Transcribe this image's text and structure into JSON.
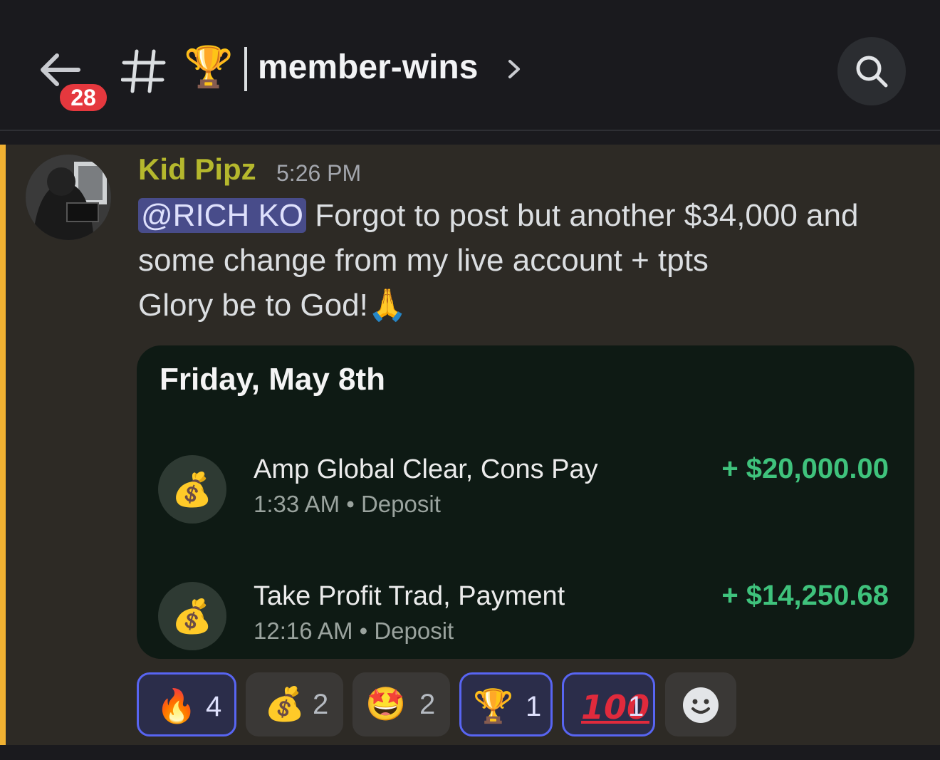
{
  "header": {
    "unread_badge": "28",
    "channel_emoji": "🏆",
    "channel_name": "member-wins",
    "icons": [
      "back-arrow-icon",
      "hash-icon",
      "chevron-right-icon",
      "search-icon"
    ]
  },
  "message": {
    "author": "Kid Pipz",
    "author_color": "#b5b82d",
    "timestamp": "5:26 PM",
    "mention": "@RICH KO",
    "text_line1": " Forgot to post but another $34,000 and",
    "text_line2": "some change from my live account + tpts",
    "text_line3": "Glory be to God!",
    "text_line3_emoji": "🙏"
  },
  "card": {
    "date": "Friday, May 8th",
    "transactions": [
      {
        "icon": "💰",
        "name": "Amp Global Clear, Cons Pay",
        "time": "1:33 AM",
        "type": "Deposit",
        "amount": "+ $20,000.00"
      },
      {
        "icon": "💰",
        "name": "Take Profit Trad, Payment",
        "time": "12:16 AM",
        "type": "Deposit",
        "amount": "+ $14,250.68"
      }
    ]
  },
  "reactions": [
    {
      "emoji": "🔥",
      "count": "4",
      "active": true
    },
    {
      "emoji": "💰",
      "count": "2",
      "active": false
    },
    {
      "emoji": "🤩",
      "count": "2",
      "active": false
    },
    {
      "emoji": "🏆",
      "count": "1",
      "active": true
    },
    {
      "emoji": "100",
      "count": "1",
      "active": true
    }
  ],
  "colors": {
    "accent_bar": "#f0b132",
    "amount_green": "#3fc27c",
    "mention_bg": "#484c8a",
    "badge_red": "#e5383e"
  }
}
